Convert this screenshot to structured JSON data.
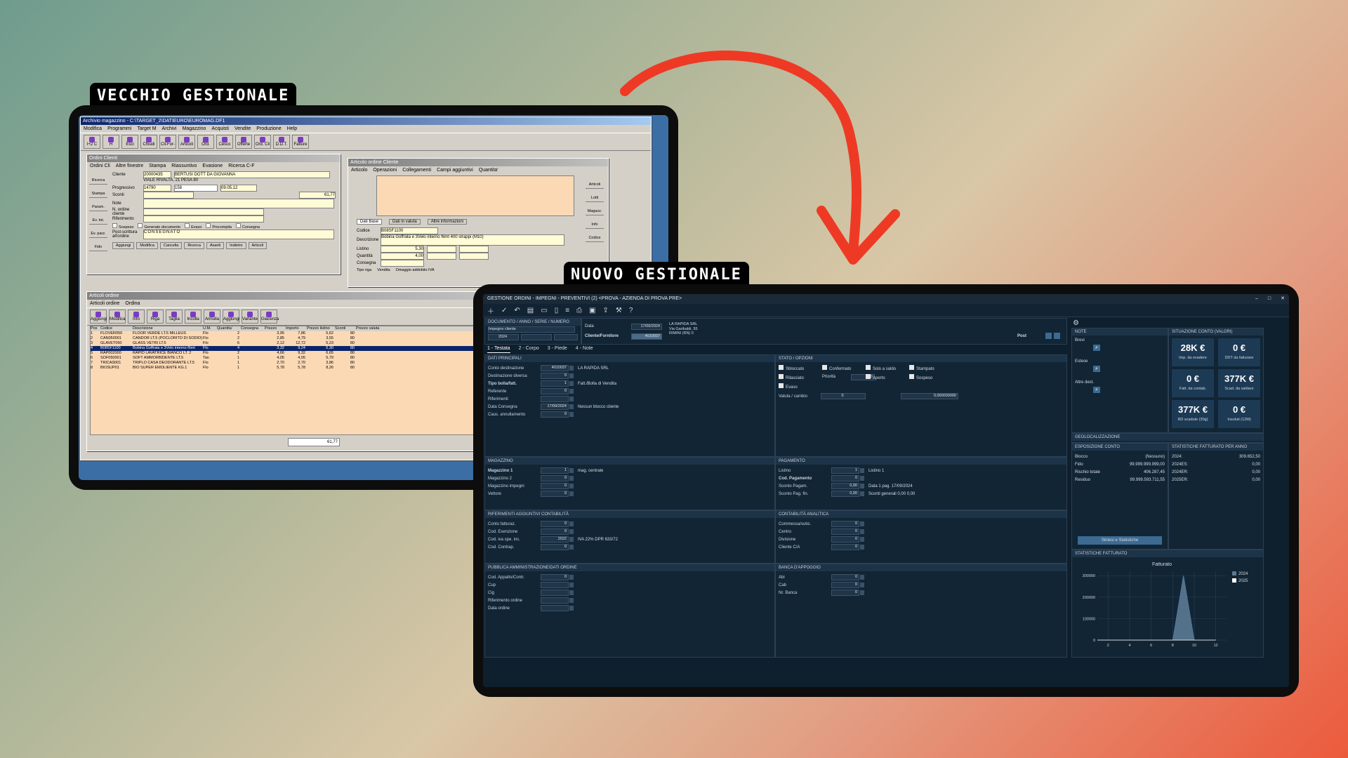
{
  "labels": {
    "old": "VECCHIO GESTIONALE",
    "new": "NUOVO GESTIONALE"
  },
  "old_app": {
    "main_title": "Archivio magazzino - C:\\TARGET_2\\DATIEURO\\EUROMAG.DF1",
    "menu": [
      "Modifica",
      "Programmi",
      "Target M",
      "Archivi",
      "Magazzino",
      "Acquisti",
      "Vendite",
      "Produzione",
      "Help"
    ],
    "toolbar": [
      "I+2 C",
      "H",
      "Esci",
      "Chiudi",
      "Cli-For-M",
      "Articoli",
      "Ord. For.",
      "Cesco",
      "Offerte",
      "Ord. Cli",
      "D.D.T.",
      "Fatture"
    ],
    "ordini": {
      "title": "Ordini Clienti",
      "menu": [
        "Ordini Cli",
        "Altre finestre",
        "Stampa",
        "Riassuntivo",
        "Evasione",
        "Ricerca C-F"
      ],
      "side": [
        "Ricerca",
        "Stampa",
        "Param.",
        "Ev. tot.",
        "Ev. parz.",
        "Fido"
      ],
      "cliente_code": "20000435",
      "cliente_name": "BERTUSI DOTT DA GIOVANNA",
      "address": "VIALE RIVALTA, 21   PESA  80",
      "progressivo": "14790",
      "numero": "158",
      "data": "09.05.12",
      "importo": "61,77",
      "fields": [
        "Cliente",
        "Progressivo",
        "Sconti",
        "Note",
        "N. ordine cliente",
        "Riferimento",
        "Post-scrittura all'ordine"
      ],
      "checks": [
        "Sospeso",
        "Generato documento",
        "Evaso",
        "Precompila",
        "Consegna"
      ],
      "note_text": "CONSEGNATO",
      "buttons": [
        "Aggiungi",
        "Modifica",
        "Cancella",
        "Ricerca",
        "Avanti",
        "Indietro",
        "Articoli"
      ]
    },
    "articolo": {
      "title": "Articolo ordine Cliente",
      "menu": [
        "Articolo",
        "Operazioni",
        "Collegamenti",
        "Campi aggiuntivi",
        "Quantita'"
      ],
      "tabs": [
        "Dati Base",
        "Dati in valuta",
        "Altre informazioni"
      ],
      "codice": "B08SF1100",
      "descrizione": "Bobina Goffrata e 3Velo interno f6mt 400 strappi (M10)",
      "listino": "5,30",
      "quantita": "4,00",
      "side": [
        "Articoli",
        "Lotti",
        "Magazz.",
        "Info",
        "Codice"
      ],
      "tipo_riga": [
        "Vendita",
        "Omaggio addebito IVA"
      ]
    },
    "articoli_ordine": {
      "title": "Articoli ordine",
      "menu": [
        "Articoli ordine",
        "Ordina"
      ],
      "toolbar": [
        "Aggiungi",
        "Modifica",
        "Info",
        "Riga coll.",
        "Taglia",
        "Incolla",
        "Annulla",
        "Aggiungi",
        "Variante",
        "Giacenza"
      ],
      "headers": [
        "Pos",
        "Codice",
        "Descrizione",
        "U.M.",
        "Quantita'",
        "Consegna",
        "Prezzo",
        "Importo",
        "Prezzo listino",
        "Sconti",
        "Prezzo valuta"
      ],
      "rows": [
        [
          "1",
          "FLOVER050",
          "FLOOR VERDE LT.5 MILLEUS",
          "Flo",
          "2",
          "",
          "3,95",
          "7,86",
          "5,62",
          "80"
        ],
        [
          "2",
          "CAN050001",
          "CANDOR LT.5 (POCLORITO DI SODIO)",
          "Flo",
          "2",
          "",
          "2,85",
          "4,79",
          "3,55",
          "80"
        ],
        [
          "3",
          "GLAVET050",
          "GLASS VETRI LT.5",
          "Flo",
          "6",
          "",
          "2,12",
          "12,72",
          "5,23",
          "80"
        ],
        [
          "4",
          "B08SF1100",
          "Bobina Goffrata e 3Velo interno f6mt",
          "Flo",
          "4",
          "",
          "3,32",
          "9,24",
          "5,30",
          "80"
        ],
        [
          "5",
          "RAP002000",
          "RAPID LAVATRICE BIANCO LT. 2",
          "Flo",
          "2",
          "",
          "4,66",
          "9,32",
          "6,65",
          "80"
        ],
        [
          "6",
          "SOF050001",
          "SOFT AMMORBIDENTE LT.5",
          "Tan",
          "1",
          "",
          "4,05",
          "4,05",
          "5,79",
          "80"
        ],
        [
          "7",
          "TRICAS001",
          "TRIPLO CASA DEODORANTE LT.5",
          "Flo",
          "1",
          "",
          "2,70",
          "2,70",
          "3,86",
          "80"
        ],
        [
          "8",
          "BIOSUP01",
          "BIO SUPER EMOLIENTE KG.1",
          "Flo",
          "1",
          "",
          "5,78",
          "5,78",
          "8,26",
          "80"
        ]
      ],
      "total": "61,77"
    }
  },
  "new_app": {
    "title": "GESTIONE ORDINI - IMPEGNI - PREVENTIVI (2) <PROVA - AZIENDA DI PROVA PRE>",
    "window_controls": [
      "–",
      "□",
      "✕"
    ],
    "header": {
      "doc_label": "DOCUMENTO / ANNO / SERIE / NUMERO",
      "doc_type": "Impegno cliente",
      "anno": "2024",
      "data_label": "Data",
      "data": "17/09/2024",
      "cliente_label": "Cliente/Fornitore",
      "cliente_code": "4010037",
      "cliente_name": "LA RAPIDA SRL",
      "cliente_addr": "Via Garibaldi, 55",
      "cliente_city": "RIMINI (RN)",
      "cliente_extra": "0",
      "post": "Post"
    },
    "tabs": [
      "1 - Testata",
      "2 - Corpo",
      "3 - Piede",
      "4 - Note"
    ],
    "dati_principali": {
      "title": "DATI PRINCIPALI",
      "rows": [
        {
          "label": "Conto destinazione",
          "value": "4010037",
          "extra": "LA RAPIDA SRL"
        },
        {
          "label": "Destinazione diversa",
          "value": "0",
          "extra": ""
        },
        {
          "label": "Tipo bolla/fatt.",
          "value": "1",
          "extra": "Fatt./Bolla di Vendita"
        },
        {
          "label": "Referente",
          "value": "0",
          "extra": ""
        },
        {
          "label": "Riferimenti",
          "value": "",
          "extra": ""
        },
        {
          "label": "Data Consegna",
          "value": "17/09/2024",
          "extra": "Nessun blocco cliente"
        },
        {
          "label": "Caus. annullamento",
          "value": "0",
          "extra": ""
        }
      ]
    },
    "stato": {
      "title": "STATO / OPZIONI",
      "checks": [
        "Sbloccato",
        "Confermato",
        "Solo a saldo",
        "Stampato",
        "Rilasciato",
        "Aperto",
        "Sospeso",
        "Evaso"
      ],
      "priorita_label": "Priorità",
      "priorita": "0",
      "valuta_label": "Valuta / cambio",
      "valuta": "0",
      "cambio": "0,000000000"
    },
    "magazzino": {
      "title": "MAGAZZINO",
      "rows": [
        {
          "label": "Magazzino 1",
          "value": "1",
          "extra": "mag. centrale"
        },
        {
          "label": "Magazzino 2",
          "value": "0",
          "extra": ""
        },
        {
          "label": "Magazzino impegni",
          "value": "0",
          "extra": ""
        },
        {
          "label": "Vettore",
          "value": "0",
          "extra": ""
        }
      ]
    },
    "pagamento": {
      "title": "PAGAMENTO",
      "rows": [
        {
          "label": "Listino",
          "value": "1",
          "extra": "Listino 1"
        },
        {
          "label": "Cod. Pagamento",
          "value": "0",
          "extra": ""
        },
        {
          "label": "Sconto Pagam.",
          "value": "0,00",
          "extra": "Data 1 pag.   17/09/2024"
        },
        {
          "label": "Sconto Pag. fin.",
          "value": "0,00",
          "extra": "Sconti generali   0,00   0,00"
        }
      ]
    },
    "riferimenti": {
      "title": "RIFERIMENTI AGGIUNTIVI CONTABILITÀ",
      "rows": [
        {
          "label": "Conto fatturaz.",
          "value": "0",
          "extra": ""
        },
        {
          "label": "Cod. Esenzione",
          "value": "0",
          "extra": ""
        },
        {
          "label": "Cod. iva spe. inc.",
          "value": "2022",
          "extra": "IVA 22% DPR 633/72"
        },
        {
          "label": "Cod. Contrap.",
          "value": "0",
          "extra": ""
        }
      ]
    },
    "contabilita": {
      "title": "CONTABILITÀ ANALITICA",
      "rows": [
        {
          "label": "Commessa/subc.",
          "value": "0"
        },
        {
          "label": "Centro",
          "value": "0"
        },
        {
          "label": "Divisione",
          "value": "0"
        },
        {
          "label": "Cliente C/A",
          "value": "0"
        }
      ]
    },
    "pa": {
      "title": "PUBBLICA AMMINISTRAZIONE/DATI ORDINE",
      "rows": [
        {
          "label": "Cod. Appalto/Contr.",
          "value": "0"
        },
        {
          "label": "Cup",
          "value": ""
        },
        {
          "label": "Cig",
          "value": ""
        },
        {
          "label": "Riferimento ordine",
          "value": ""
        },
        {
          "label": "Data ordine",
          "value": ""
        }
      ]
    },
    "banca": {
      "title": "BANCA D'APPOGGIO",
      "rows": [
        {
          "label": "Abi",
          "value": "0"
        },
        {
          "label": "Cab",
          "value": "0"
        },
        {
          "label": "Nr. Banca",
          "value": "0"
        }
      ]
    },
    "note": {
      "title": "NOTE",
      "items": [
        "Brevi",
        "Estese",
        "Altre dest."
      ]
    },
    "situazione": {
      "title": "SITUAZIONE CONTO (VALORI)",
      "kpis": [
        {
          "value": "28K €",
          "label": "Imp. da evadere"
        },
        {
          "value": "0 €",
          "label": "DDT da fatturare"
        },
        {
          "value": "0 €",
          "label": "Fatt. da contab."
        },
        {
          "value": "377K €",
          "label": "Scad. da saldare"
        },
        {
          "value": "377K €",
          "label": "RD scadute (30g)"
        },
        {
          "value": "0 €",
          "label": "Insoluti (12M)"
        }
      ]
    },
    "geo": {
      "title": "GEOLOCALIZZAZIONE"
    },
    "esposizione": {
      "title": "ESPOSIZIONE CONTO",
      "rows": [
        {
          "label": "Blocco",
          "value": "(Nessuno)"
        },
        {
          "label": "Fido",
          "value": "99.999.999.999,00"
        },
        {
          "label": "Rischio totale",
          "value": "406.287,45"
        },
        {
          "label": "Residuo",
          "value": "99.999.593.711,55"
        }
      ],
      "button": "Sintesi e Statistiche"
    },
    "stat_anno": {
      "title": "STATISTICHE FATTURATO PER ANNO",
      "rows": [
        {
          "label": "2024:",
          "value": "309.652,50"
        },
        {
          "label": "2024ES:",
          "value": "0,00"
        },
        {
          "label": "2024ER:",
          "value": "0,00"
        },
        {
          "label": "2025ER:",
          "value": "0,00"
        }
      ]
    },
    "stat_fatturato": {
      "title": "STATISTICHE FATTURATO"
    }
  },
  "chart_data": {
    "type": "area",
    "title": "Fatturato",
    "x": [
      1,
      2,
      3,
      4,
      5,
      6,
      7,
      8,
      9,
      10,
      11,
      12
    ],
    "xticks": [
      2,
      4,
      6,
      8,
      10,
      12
    ],
    "yticks": [
      0,
      100000,
      200000,
      300000
    ],
    "ytick_labels": [
      "0",
      "100000",
      "200000",
      "300000"
    ],
    "ylim": [
      0,
      320000
    ],
    "xlim": [
      1,
      13
    ],
    "series": [
      {
        "name": "2024",
        "values": [
          0,
          0,
          0,
          0,
          0,
          0,
          0,
          0,
          300000,
          0,
          0,
          0
        ],
        "color": "#5b7a94"
      },
      {
        "name": "2025",
        "values": [
          0,
          0,
          0,
          0,
          0,
          0,
          0,
          0,
          0,
          0,
          0,
          0
        ],
        "color": "#ffffff"
      }
    ],
    "legend": "top-right",
    "grid": true
  },
  "colors": {
    "arrow": "#ee3a24",
    "new_bg": "#0e1f2d",
    "old_bg": "#d4d0c8"
  }
}
